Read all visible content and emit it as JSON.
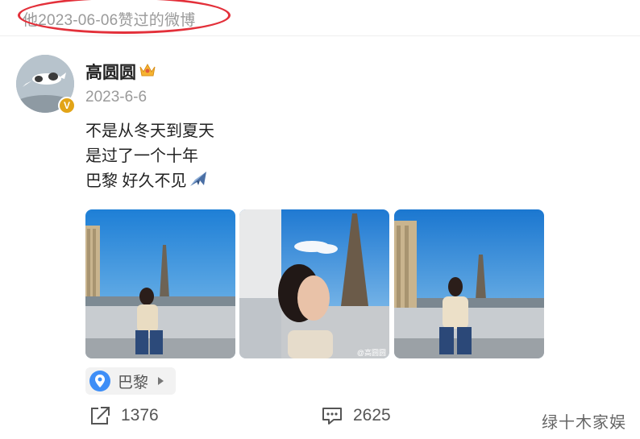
{
  "header": {
    "liked_line": "他2023-06-06赞过的微博"
  },
  "post": {
    "username": "高圆圆",
    "date": "2023-6-6",
    "lines": [
      "不是从冬天到夏天",
      "是过了一个十年",
      "巴黎 好久不见"
    ],
    "location": "巴黎",
    "photo_watermark": "@高圆圆"
  },
  "actions": {
    "reposts": "1376",
    "comments": "2625"
  },
  "watermark": "绿十木家娱",
  "icons": {
    "crown": "crown-icon",
    "verified": "verified-badge-icon",
    "plane": "airplane-icon",
    "location": "location-pin-icon",
    "share": "share-icon",
    "comment": "comment-icon"
  },
  "colors": {
    "highlight_ellipse": "#e3303a",
    "location_pin": "#3e8ef7",
    "verified_badge": "#e2a417"
  }
}
